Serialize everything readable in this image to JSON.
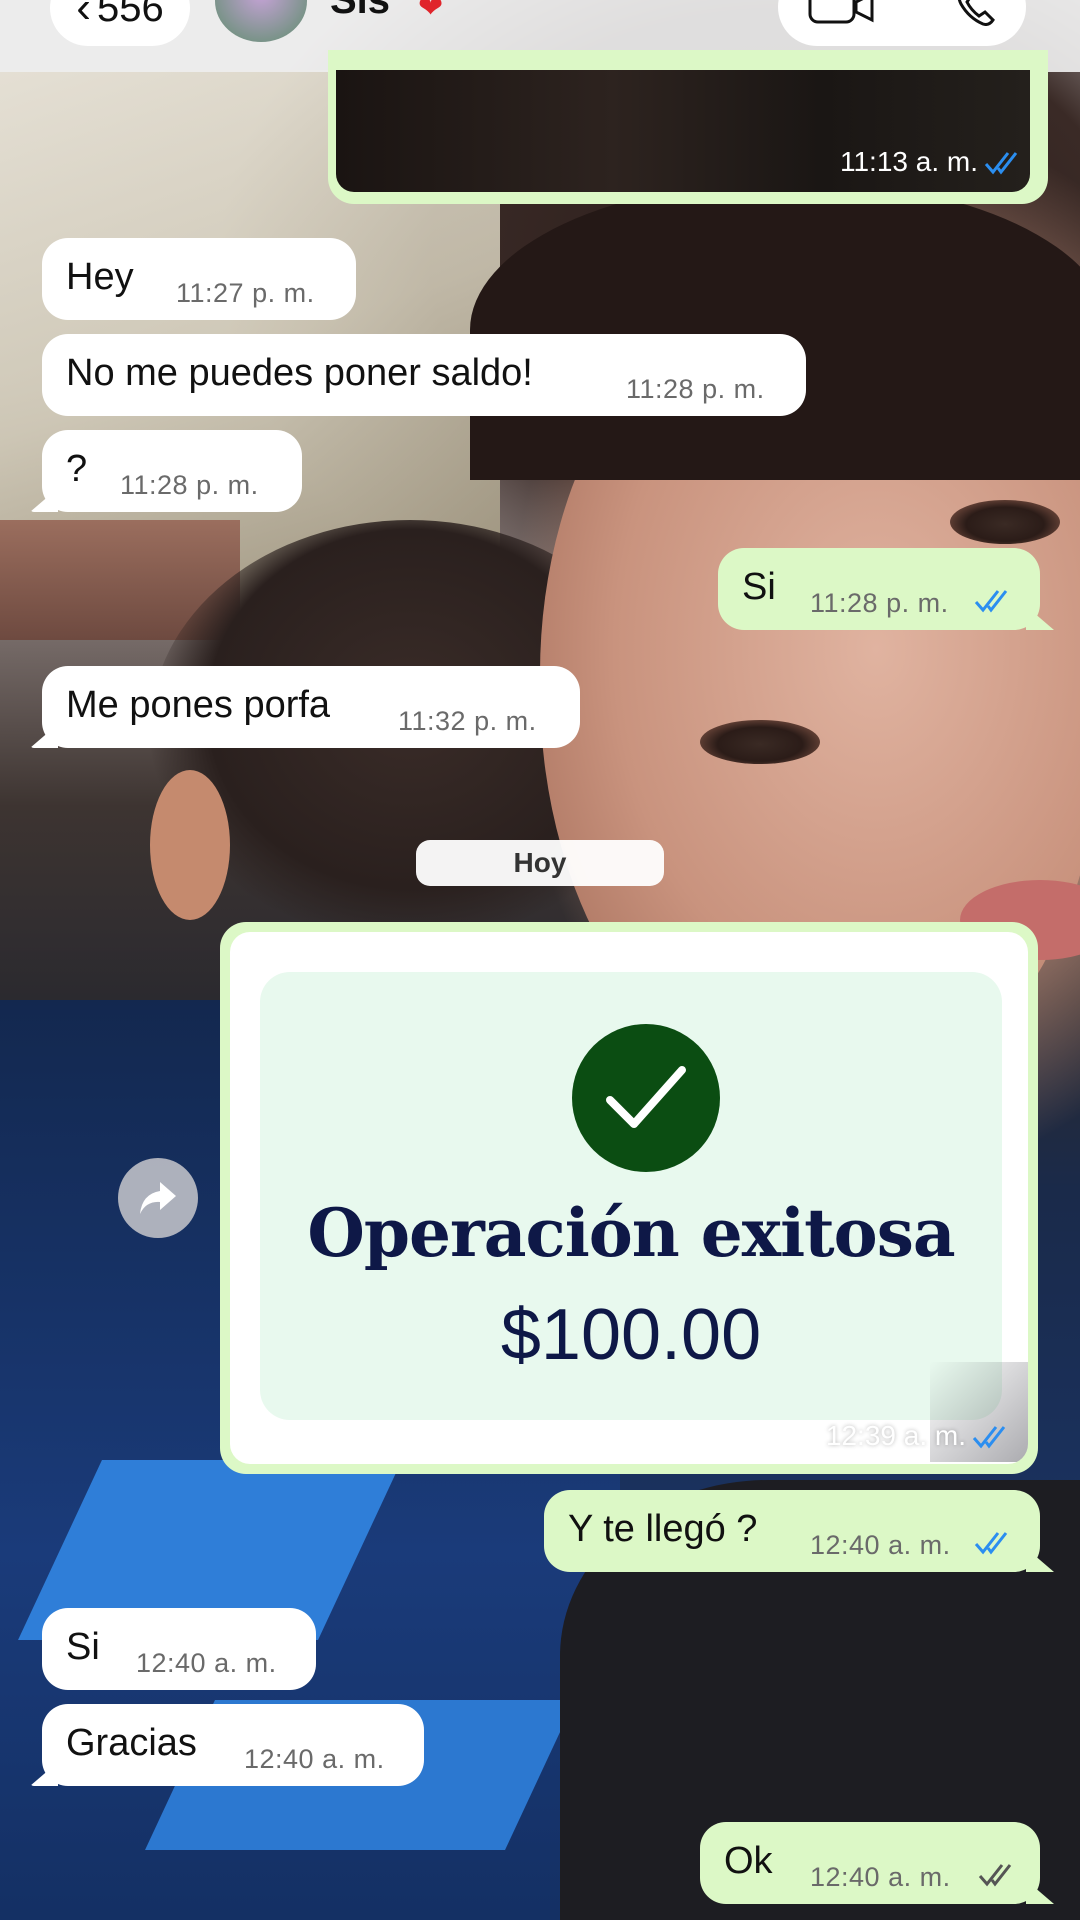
{
  "header": {
    "back_label": "556",
    "contact_name": "Sis",
    "heart": "❤",
    "video_icon": "video-camera-icon",
    "call_icon": "phone-icon"
  },
  "messages": {
    "image_time": "11:13 a. m.",
    "m1": {
      "text": "Hey",
      "time": "11:27 p. m."
    },
    "m2": {
      "text": "No me puedes poner saldo!",
      "time": "11:28 p. m."
    },
    "m3": {
      "text": "?",
      "time": "11:28 p. m."
    },
    "m4": {
      "text": "Si",
      "time": "11:28 p. m."
    },
    "m5": {
      "text": "Me pones porfa",
      "time": "11:32 p. m."
    },
    "date_divider": "Hoy",
    "receipt": {
      "title": "Operación exitosa",
      "amount": "$100.00",
      "time": "12:39 a. m."
    },
    "m6": {
      "text": "Y te llegó ?",
      "time": "12:40 a. m."
    },
    "m7": {
      "text": "Si",
      "time": "12:40 a. m."
    },
    "m8": {
      "text": "Gracias",
      "time": "12:40 a. m."
    },
    "m9": {
      "text": "Ok",
      "time": "12:40 a. m."
    }
  },
  "colors": {
    "outgoing_bubble": "#dcf8c6",
    "incoming_bubble": "#ffffff",
    "read_tick": "#2b8ef0",
    "delivered_tick": "#555555",
    "success_green": "#0b4d12",
    "receipt_text": "#0e1847"
  }
}
